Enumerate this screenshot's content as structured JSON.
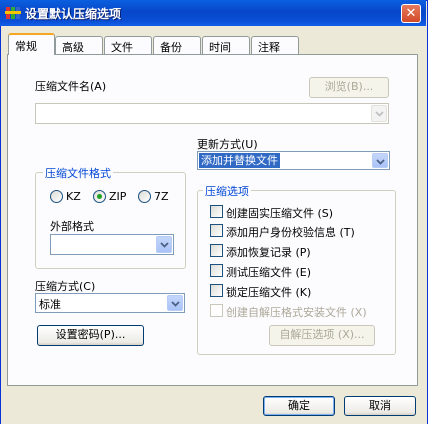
{
  "window": {
    "title": "设置默认压缩选项"
  },
  "tabs": [
    {
      "label": "常规"
    },
    {
      "label": "高级"
    },
    {
      "label": "文件"
    },
    {
      "label": "备份"
    },
    {
      "label": "时间"
    },
    {
      "label": "注释"
    }
  ],
  "archive_name": {
    "label": "压缩文件名(A)",
    "value": "",
    "browse_label": "浏览(B)..."
  },
  "update_mode": {
    "label": "更新方式(U)",
    "selected": "添加并替换文件"
  },
  "format_group": {
    "title": "压缩文件格式",
    "options": [
      {
        "label": "KZ"
      },
      {
        "label": "ZIP"
      },
      {
        "label": "7Z"
      }
    ],
    "selected": "ZIP",
    "external_label": "外部格式",
    "external_value": ""
  },
  "method": {
    "label": "压缩方式(C)",
    "selected": "标准"
  },
  "password_button": "设置密码(P)...",
  "options_group": {
    "title": "压缩选项",
    "items": [
      {
        "label": "创建固实压缩文件 (S)"
      },
      {
        "label": "添加用户身份校验信息 (T)"
      },
      {
        "label": "添加恢复记录 (P)"
      },
      {
        "label": "测试压缩文件 (E)"
      },
      {
        "label": "锁定压缩文件 (K)"
      },
      {
        "label": "创建自解压格式安装文件 (X)"
      }
    ],
    "sfx_button": "自解压选项 (X)..."
  },
  "footer": {
    "ok": "确定",
    "cancel": "取消"
  }
}
